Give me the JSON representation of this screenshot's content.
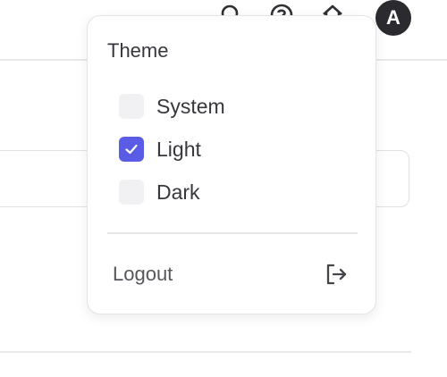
{
  "header": {
    "avatar_initial": "A",
    "icons": [
      "search-icon",
      "help-icon",
      "home-icon"
    ]
  },
  "theme_menu": {
    "title": "Theme",
    "options": [
      {
        "label": "System",
        "checked": false
      },
      {
        "label": "Light",
        "checked": true
      },
      {
        "label": "Dark",
        "checked": false
      }
    ],
    "logout_label": "Logout",
    "logout_icon": "logout-icon"
  },
  "colors": {
    "accent": "#5b5ce6",
    "avatar_bg": "#2a2a2f",
    "checkbox_bg": "#f1f1f3"
  }
}
